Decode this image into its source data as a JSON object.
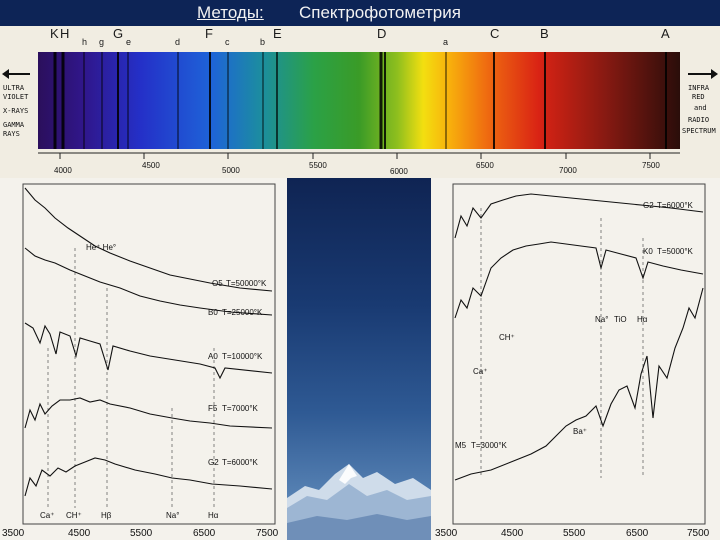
{
  "title": {
    "part1": "Методы:",
    "part2": "Спектрофотометрия"
  },
  "spectrum": {
    "letters": [
      "K",
      "H",
      "h",
      "g",
      "G",
      "e",
      "d",
      "F",
      "c",
      "b",
      "E",
      "D",
      "a",
      "C",
      "B",
      "A"
    ],
    "left_labels": [
      "ULTRA",
      "VIOLET",
      "X-RAYS",
      "GAMMA",
      "RAYS"
    ],
    "right_labels": [
      "INFRA",
      "RED",
      "and",
      "RADIO",
      "SPECTRUM"
    ],
    "scale": [
      "4000",
      "4500",
      "5000",
      "5500",
      "6000",
      "6500",
      "7000",
      "7500"
    ]
  },
  "left_plot": {
    "spectral_types": [
      {
        "label": "O5",
        "temp": "T=50000°K"
      },
      {
        "label": "B0",
        "temp": "T=25000°K"
      },
      {
        "label": "A0",
        "temp": "T=10000°K"
      },
      {
        "label": "F5",
        "temp": "T=7000°K"
      },
      {
        "label": "G2",
        "temp": "T=6000°K"
      }
    ],
    "line_labels": [
      "Ca⁺",
      "CH⁺",
      "Hβ",
      "Na°",
      "Hα"
    ],
    "top_labels": [
      "He⁺ He°"
    ],
    "x_ticks": [
      "3500",
      "4500",
      "5500",
      "6500",
      "7500"
    ]
  },
  "right_plot": {
    "spectral_types": [
      {
        "label": "G2",
        "temp": "T=6000°K"
      },
      {
        "label": "K0",
        "temp": "T=5000°K"
      },
      {
        "label": "M5",
        "temp": "T=3000°K"
      }
    ],
    "line_labels": [
      "Na°",
      "TiO",
      "Hα",
      "CH⁺",
      "Ca⁺",
      "Ba⁺"
    ],
    "x_ticks": [
      "3500",
      "4500",
      "5500",
      "6500",
      "7500"
    ]
  }
}
